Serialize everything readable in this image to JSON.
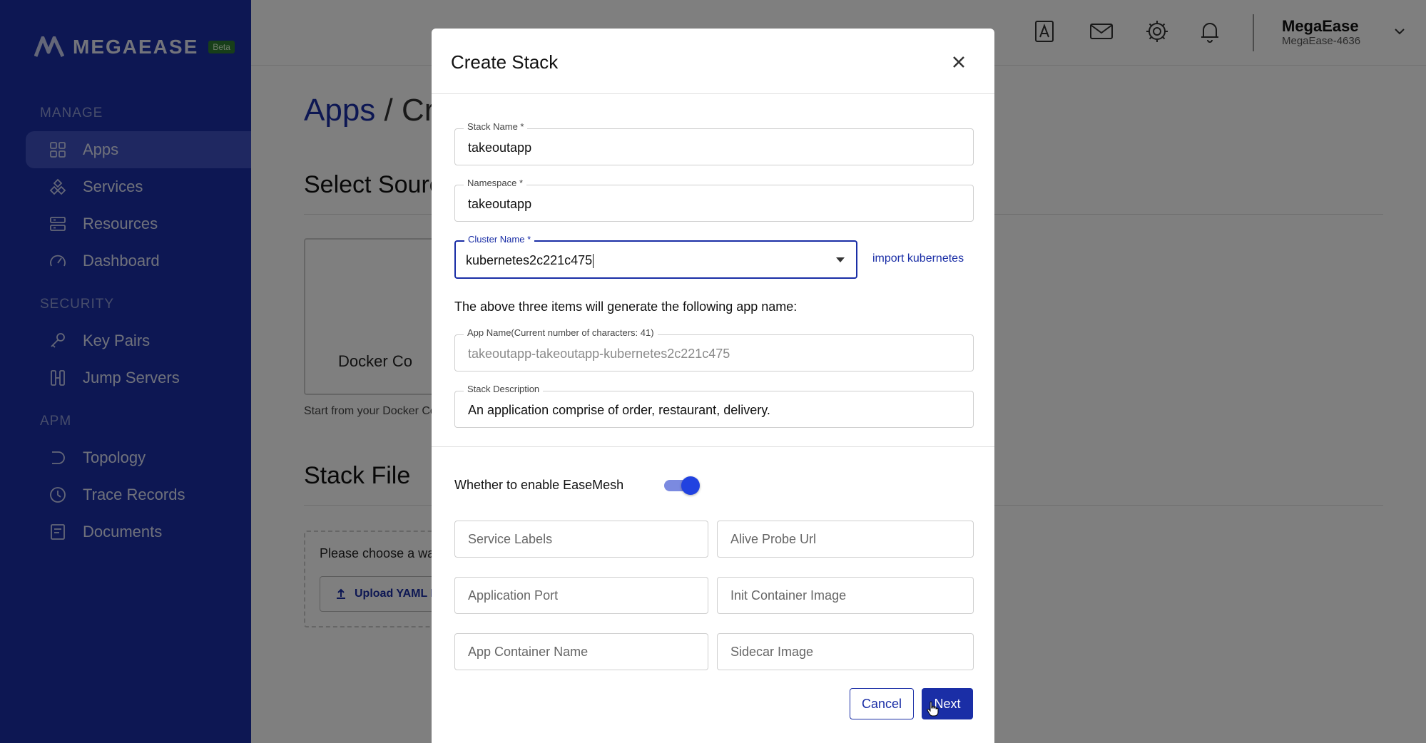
{
  "brand": {
    "name": "MEGAEASE",
    "badge": "Beta"
  },
  "sidebar": {
    "sections": [
      {
        "title": "MANAGE",
        "items": [
          {
            "label": "Apps",
            "icon": "apps-grid-icon",
            "active": true
          },
          {
            "label": "Services",
            "icon": "services-icon"
          },
          {
            "label": "Resources",
            "icon": "resources-icon"
          },
          {
            "label": "Dashboard",
            "icon": "dashboard-gauge-icon"
          }
        ]
      },
      {
        "title": "SECURITY",
        "items": [
          {
            "label": "Key Pairs",
            "icon": "key-icon"
          },
          {
            "label": "Jump Servers",
            "icon": "jump-servers-icon"
          }
        ]
      },
      {
        "title": "APM",
        "items": [
          {
            "label": "Topology",
            "icon": "topology-icon"
          },
          {
            "label": "Trace Records",
            "icon": "clock-icon"
          },
          {
            "label": "Documents",
            "icon": "document-icon"
          }
        ]
      }
    ]
  },
  "header": {
    "icons": [
      "contacts-icon",
      "mail-icon",
      "gear-icon",
      "bell-icon"
    ],
    "user": {
      "name": "MegaEase",
      "id": "MegaEase-4636"
    }
  },
  "background": {
    "breadcrumb_apps": "Apps",
    "breadcrumb_sep": "/",
    "breadcrumb_rest": "Cr",
    "select_source_heading": "Select Sourc",
    "docker_card_label": "Docker Co",
    "start_text": "Start from your Docker Co",
    "stack_file_heading": "Stack File",
    "choose_text": "Please choose a wa",
    "upload_label": "Upload YAML F"
  },
  "modal": {
    "title": "Create Stack",
    "fields": {
      "stack_name": {
        "label": "Stack Name *",
        "value": "takeoutapp"
      },
      "namespace": {
        "label": "Namespace *",
        "value": "takeoutapp"
      },
      "cluster_name": {
        "label": "Cluster Name *",
        "value": "kubernetes2c221c475"
      },
      "app_name": {
        "label": "App Name(Current number of characters: 41)",
        "value": "takeoutapp-takeoutapp-kubernetes2c221c475"
      },
      "stack_description": {
        "label": "Stack Description",
        "value": "An application comprise of order, restaurant, delivery."
      }
    },
    "import_link": "import kubernetes",
    "info_text": "The above three items will generate the following app name:",
    "easemesh_label": "Whether to enable EaseMesh",
    "easemesh_enabled": true,
    "mesh_fields": {
      "service_labels": "Service Labels",
      "alive_probe_url": "Alive Probe Url",
      "application_port": "Application Port",
      "init_container_image": "Init Container Image",
      "app_container_name": "App Container Name",
      "sidecar_image": "Sidecar Image"
    },
    "buttons": {
      "cancel": "Cancel",
      "next": "Next"
    }
  },
  "colors": {
    "sidebar": "#1a2ea6",
    "primary": "#1a2ea6",
    "toggle": "#2142e0"
  }
}
